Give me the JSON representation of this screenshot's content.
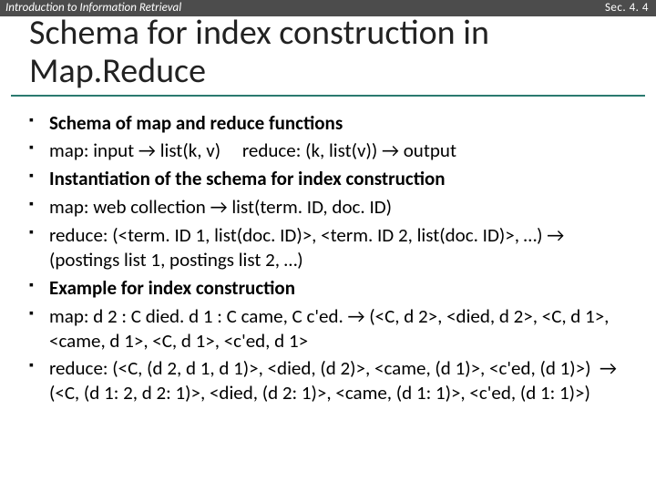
{
  "header": {
    "left": "Introduction to Information Retrieval",
    "right": "Sec. 4. 4"
  },
  "title": "Schema for index construction in Map.Reduce",
  "bullets": [
    {
      "html": "<span class='bold'>Schema of map and reduce functions</span>"
    },
    {
      "html": "map: input → list(k, v) &nbsp;&nbsp;&nbsp; reduce: (k, list(v)) → output"
    },
    {
      "html": "<span class='bold'>Instantiation of the schema for index construction</span>"
    },
    {
      "html": "map: web collection → list(term. ID, doc. ID)"
    },
    {
      "html": "reduce: (&lt;term. ID 1, list(doc. ID)&gt;, &lt;term. ID 2, list(doc. ID)&gt;, …) → (postings list 1, postings list 2, …)"
    },
    {
      "html": "<span class='bold'>Example for index construction</span>"
    },
    {
      "html": "map: d 2 : C died. d 1 : C came, C c'ed. → (&lt;C, d 2&gt;, &lt;died, d 2&gt;, &lt;C, d 1&gt;, &lt;came, d 1&gt;, &lt;C, d 1&gt;, &lt;c'ed, d 1&gt;"
    },
    {
      "html": "reduce: (&lt;C, (d 2, d 1, d 1)&gt;, &lt;died, (d 2)&gt;, &lt;came, (d 1)&gt;, &lt;c'ed, (d 1)&gt;) &nbsp;→&nbsp; (&lt;C, (d 1: 2, d 2: 1)&gt;, &lt;died, (d 2: 1)&gt;, &lt;came, (d 1: 1)&gt;, &lt;c'ed, (d 1: 1)&gt;)"
    }
  ]
}
